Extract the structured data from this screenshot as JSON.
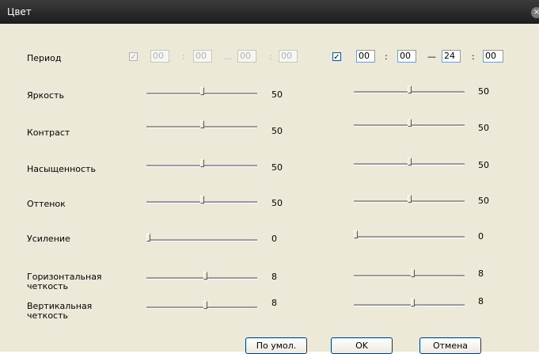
{
  "window": {
    "title": "Цвет",
    "close_icon": "close-icon"
  },
  "period": {
    "label": "Период",
    "left": {
      "checked": true,
      "enabled": false,
      "check_mark": "✓",
      "start_h": "00",
      "start_m": "00",
      "end_h": "00",
      "end_m": "00",
      "colon": ":",
      "dash": "...",
      "enabled_state": "disabled"
    },
    "right": {
      "checked": true,
      "enabled": true,
      "check_mark": "✓",
      "start_h": "00",
      "start_m": "00",
      "end_h": "24",
      "end_m": "00",
      "colon": ":",
      "dash": "—"
    }
  },
  "sliders": [
    {
      "key": "brightness",
      "label": "Яркость",
      "min": 0,
      "max": 100,
      "left_value": "50",
      "right_value": "50"
    },
    {
      "key": "contrast",
      "label": "Контраст",
      "min": 0,
      "max": 100,
      "left_value": "50",
      "right_value": "50"
    },
    {
      "key": "saturation",
      "label": "Насыщенность",
      "min": 0,
      "max": 100,
      "left_value": "50",
      "right_value": "50"
    },
    {
      "key": "hue",
      "label": "Оттенок",
      "min": 0,
      "max": 100,
      "left_value": "50",
      "right_value": "50"
    },
    {
      "key": "gain",
      "label": "Усиление",
      "min": 0,
      "max": 100,
      "left_value": "0",
      "right_value": "0"
    },
    {
      "key": "h-sharpness",
      "label": "Горизонтальная четкость",
      "min": 0,
      "max": 15,
      "left_value": "8",
      "right_value": "8"
    },
    {
      "key": "v-sharpness",
      "label": "Вертикальная четкость",
      "min": 0,
      "max": 15,
      "left_value": "8",
      "right_value": "8"
    }
  ],
  "buttons": {
    "default": "По умол.",
    "ok": "OK",
    "cancel": "Отмена"
  }
}
